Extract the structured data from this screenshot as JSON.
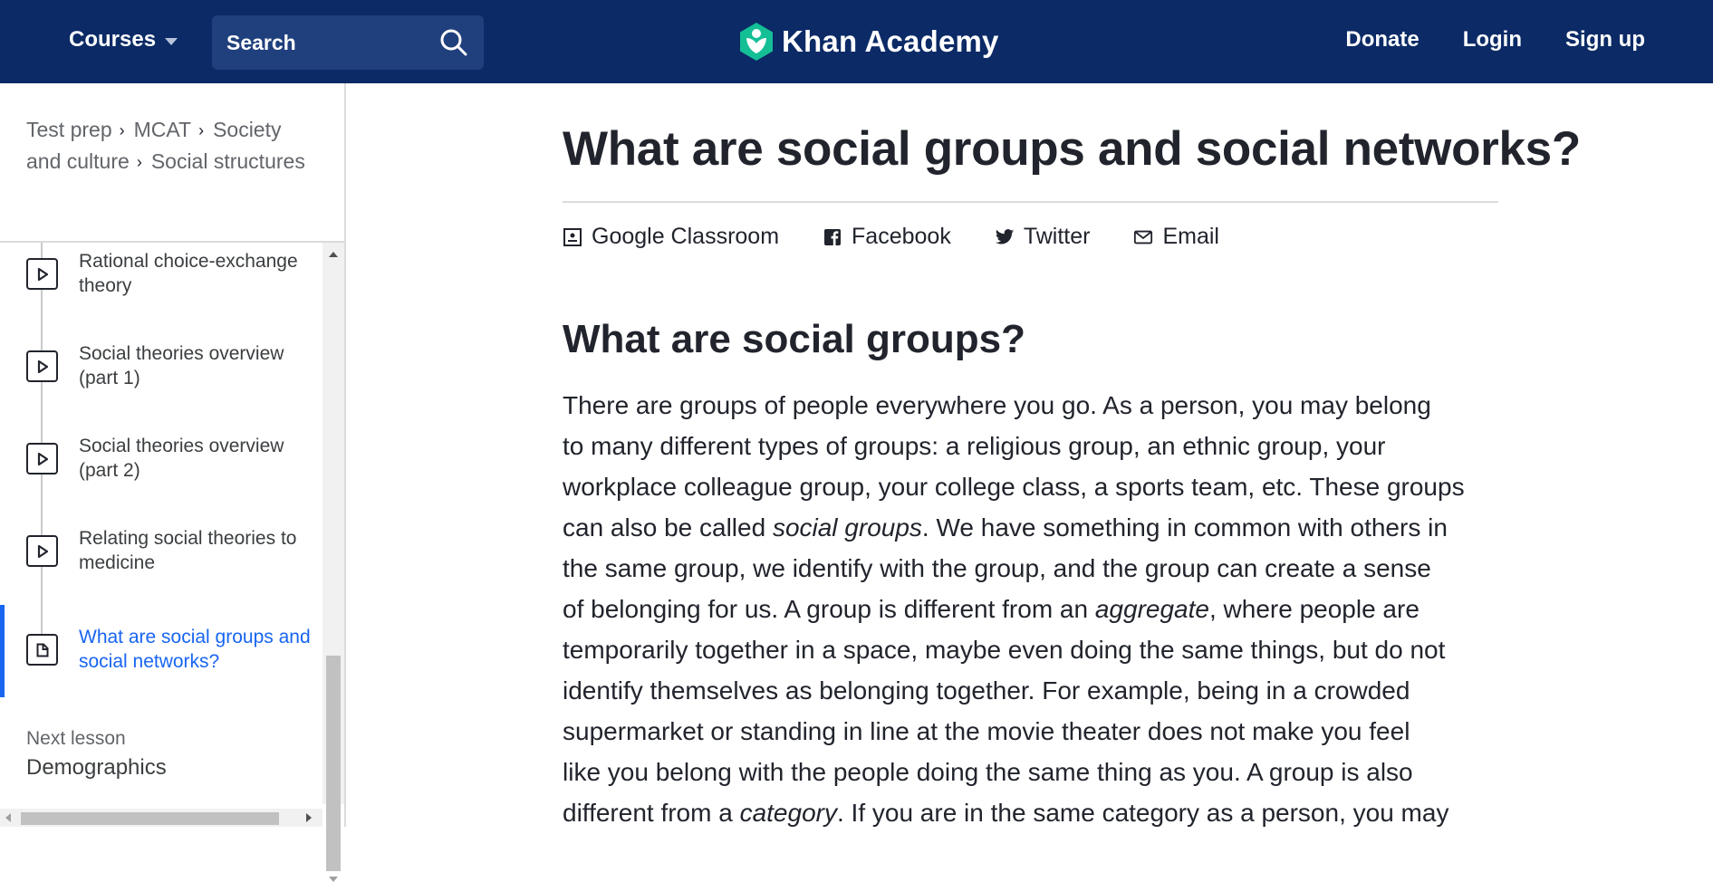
{
  "header": {
    "courses_label": "Courses",
    "search_label": "Search",
    "brand_name": "Khan Academy",
    "nav": {
      "donate": "Donate",
      "login": "Login",
      "signup": "Sign up"
    },
    "background_color": "#0b2a66",
    "brand_color": "#14bf96"
  },
  "sidebar": {
    "breadcrumb": [
      "Test prep",
      "MCAT",
      "Society and culture",
      "Social structures"
    ],
    "items": [
      {
        "label": "Rational choice-exchange theory",
        "icon": "video-play-icon",
        "active": false
      },
      {
        "label": "Social theories overview (part 1)",
        "icon": "video-play-icon",
        "active": false
      },
      {
        "label": "Social theories overview (part 2)",
        "icon": "video-play-icon",
        "active": false
      },
      {
        "label": "Relating social theories to medicine",
        "icon": "video-play-icon",
        "active": false
      },
      {
        "label": "What are social groups and social networks?",
        "icon": "article-icon",
        "active": true
      }
    ],
    "next_lesson_label": "Next lesson",
    "next_lesson_title": "Demographics",
    "active_color": "#1865f2"
  },
  "main": {
    "title": "What are social groups and social networks?",
    "share": {
      "google_classroom": "Google Classroom",
      "facebook": "Facebook",
      "twitter": "Twitter",
      "email": "Email"
    },
    "section_title": "What are social groups?",
    "paragraph_lines": [
      "There are groups of people everywhere you go. As a person, you may belong",
      "to many different types of groups: a religious group, an ethnic group, your",
      "workplace colleague group, your college class, a sports team, etc. These groups",
      [
        "can also be called ",
        "social groups",
        ". We have something in common with others in"
      ],
      "the same group, we identify with the group, and the group can create a sense",
      [
        "of belonging for us. A group is different from an ",
        "aggregate",
        ", where people are"
      ],
      "temporarily together in a space, maybe even doing the same things, but do not",
      "identify themselves as belonging together. For example, being in a crowded",
      "supermarket or standing in line at the movie theater does not make you feel",
      "like you belong with the people doing the same thing as you. A group is also",
      [
        "different from a ",
        "category",
        ". If you are in the same category as a person, you may"
      ]
    ]
  }
}
